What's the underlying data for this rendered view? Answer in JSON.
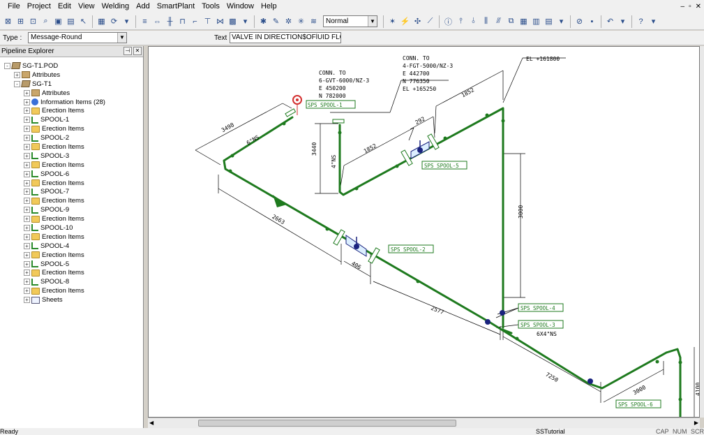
{
  "menu": [
    "File",
    "Project",
    "Edit",
    "View",
    "Welding",
    "Add",
    "SmartPlant",
    "Tools",
    "Window",
    "Help"
  ],
  "window_controls": [
    "–",
    "▫",
    "✕"
  ],
  "toolbar": {
    "style_value": "Normal"
  },
  "propbar": {
    "type_label": "Type :",
    "type_value": "Message-Round",
    "text_label": "Text",
    "text_value": "VALVE IN DIRECTION$OFlUID FLOW"
  },
  "explorer": {
    "title": "Pipeline Explorer",
    "tree": [
      {
        "label": "SG-T1.POD",
        "level": 0,
        "icon": "pod-icon",
        "expander": "-"
      },
      {
        "label": "Attributes",
        "level": 1,
        "icon": "attributes-icon",
        "expander": "+"
      },
      {
        "label": "SG-T1",
        "level": 1,
        "icon": "pod-icon",
        "expander": "-"
      },
      {
        "label": "Attributes",
        "level": 2,
        "icon": "attributes-icon",
        "expander": "+"
      },
      {
        "label": "Information Items (28)",
        "level": 2,
        "icon": "info-icon",
        "expander": "+"
      },
      {
        "label": "Erection Items",
        "level": 2,
        "icon": "folder-icon",
        "expander": "+"
      },
      {
        "label": "SPOOL-1",
        "level": 2,
        "icon": "spool-icon",
        "expander": "+"
      },
      {
        "label": "Erection Items",
        "level": 2,
        "icon": "folder-icon",
        "expander": "+"
      },
      {
        "label": "SPOOL-2",
        "level": 2,
        "icon": "spool-icon",
        "expander": "+"
      },
      {
        "label": "Erection Items",
        "level": 2,
        "icon": "folder-icon",
        "expander": "+"
      },
      {
        "label": "SPOOL-3",
        "level": 2,
        "icon": "spool-icon",
        "expander": "+"
      },
      {
        "label": "Erection Items",
        "level": 2,
        "icon": "folder-icon",
        "expander": "+"
      },
      {
        "label": "SPOOL-6",
        "level": 2,
        "icon": "spool-icon",
        "expander": "+"
      },
      {
        "label": "Erection Items",
        "level": 2,
        "icon": "folder-icon",
        "expander": "+"
      },
      {
        "label": "SPOOL-7",
        "level": 2,
        "icon": "spool-icon",
        "expander": "+"
      },
      {
        "label": "Erection Items",
        "level": 2,
        "icon": "folder-icon",
        "expander": "+"
      },
      {
        "label": "SPOOL-9",
        "level": 2,
        "icon": "spool-icon",
        "expander": "+"
      },
      {
        "label": "Erection Items",
        "level": 2,
        "icon": "folder-icon",
        "expander": "+"
      },
      {
        "label": "SPOOL-10",
        "level": 2,
        "icon": "spool-icon",
        "expander": "+"
      },
      {
        "label": "Erection Items",
        "level": 2,
        "icon": "folder-icon",
        "expander": "+"
      },
      {
        "label": "SPOOL-4",
        "level": 2,
        "icon": "spool-icon",
        "expander": "+"
      },
      {
        "label": "Erection Items",
        "level": 2,
        "icon": "folder-icon",
        "expander": "+"
      },
      {
        "label": "SPOOL-5",
        "level": 2,
        "icon": "spool-icon",
        "expander": "+"
      },
      {
        "label": "Erection Items",
        "level": 2,
        "icon": "folder-icon",
        "expander": "+"
      },
      {
        "label": "SPOOL-8",
        "level": 2,
        "icon": "spool-icon",
        "expander": "+"
      },
      {
        "label": "Erection Items",
        "level": 2,
        "icon": "folder-icon",
        "expander": "+"
      },
      {
        "label": "Sheets",
        "level": 2,
        "icon": "sheets-icon",
        "expander": "+"
      }
    ]
  },
  "drawing": {
    "conn1": [
      "CONN. TO",
      "6-GVT-6000/NZ-3",
      "E 450200",
      "N 782000"
    ],
    "conn2": [
      "CONN. TO",
      "4-FGT-5000/NZ-3",
      "E 442700",
      "N 776350",
      "EL +165250"
    ],
    "el_label": "EL +161800",
    "dims": {
      "d3498": "3498",
      "d6ns": "6\"NS",
      "d3440": "3440",
      "d4ns": "4\"NS",
      "d1852a": "1852",
      "d1852b": "1852",
      "d292": "292",
      "d2663": "2663",
      "d406": "406",
      "d3000a": "3000",
      "d2577": "2577",
      "d7250": "7250",
      "d3000b": "3000",
      "d4100": "4100",
      "d6x4ns": "6X4\"NS"
    },
    "spool_tags": {
      "tag_top": "SPS SPOOL-1",
      "spool5": "SPS SPOOL-5",
      "spool2": "SPS SPOOL-2",
      "spool4": "SPS SPOOL-4",
      "spool3": "SPS SPOOL-3",
      "spool6": "SPS SPOOL-6"
    },
    "pipe_color": "#1e7a1e",
    "tag_color": "#1e7a1e",
    "weld_color": "#1a237e",
    "marker_color": "#d32f2f"
  },
  "status": {
    "ready": "Ready",
    "project": "SSTutorial",
    "indicators": [
      "CAP",
      "NUM",
      "SCR"
    ]
  }
}
